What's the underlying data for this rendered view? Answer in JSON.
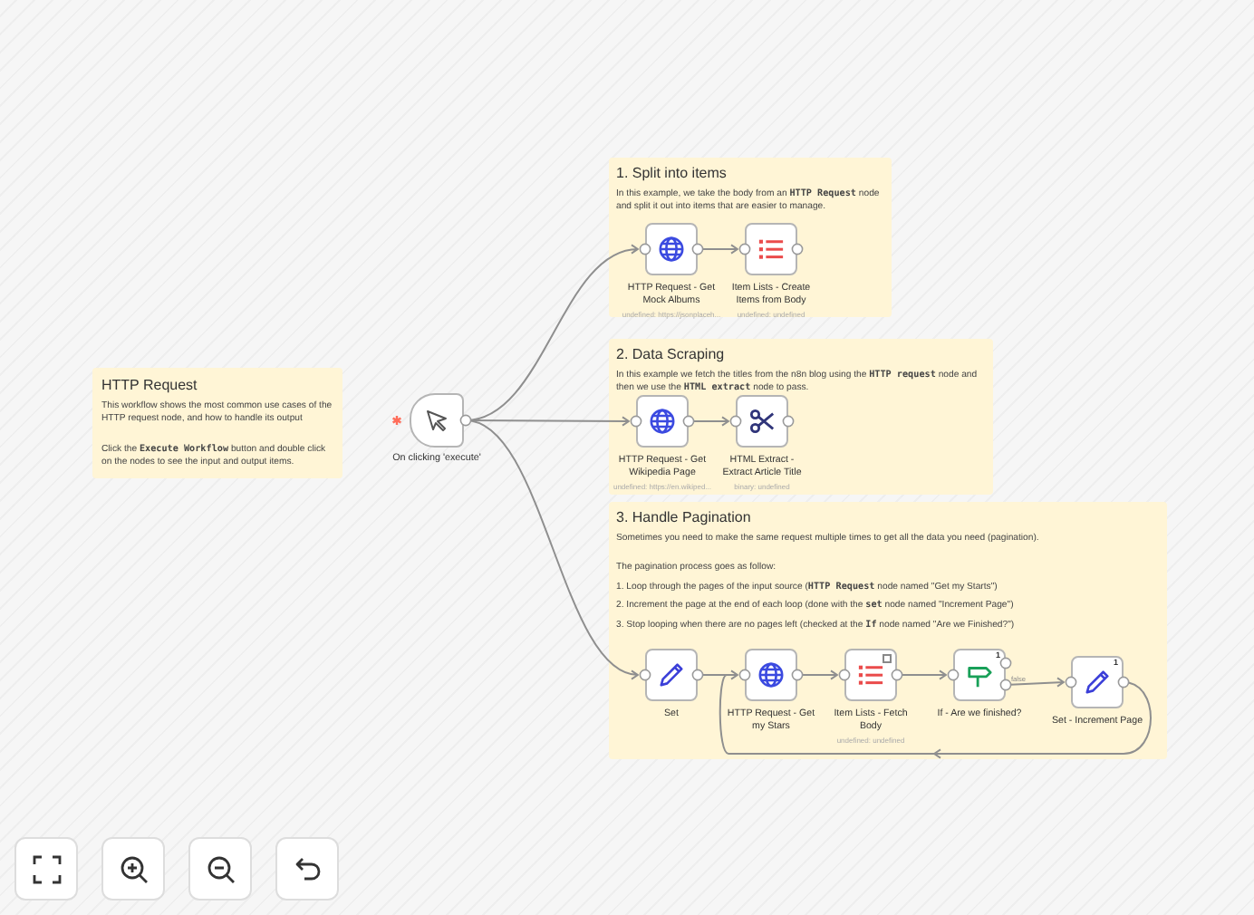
{
  "notes": [
    {
      "title": "HTTP Request",
      "paragraphs": [
        "This workflow shows the most common use cases of the HTTP request node, and how to handle its output",
        "Click the **Execute Workflow** button and double click on the nodes to see the input and output items."
      ]
    },
    {
      "title": "1. Split into items",
      "paragraphs": [
        "In this example, we take the body from an **HTTP Request** node and split it out into items that are easier to manage."
      ]
    },
    {
      "title": "2. Data Scraping",
      "paragraphs": [
        "In this example we fetch the titles from the n8n blog using the **HTTP request** node and then we use the **HTML extract** node to pass."
      ]
    },
    {
      "title": "3. Handle Pagination",
      "paragraphs": [
        "Sometimes you need to make the same request multiple times to get all the data you need (pagination).",
        "The pagination process goes as follow:",
        "1. Loop through the pages of the input source (**HTTP Request** node named \"Get my Starts\")",
        "2. Increment the page at the end of each loop (done with the **set** node named \"Increment Page\")",
        "3. Stop looping when there are no pages left (checked at the **If** node named \"Are we Finished?\")"
      ]
    }
  ],
  "trigger": {
    "label": "On clicking 'execute'"
  },
  "nodes": [
    {
      "kind": "globe",
      "label": "HTTP Request - Get Mock Albums",
      "subtitle": "undefined: https://jsonplaceh..."
    },
    {
      "kind": "list",
      "label": "Item Lists - Create Items from Body",
      "subtitle": "undefined: undefined"
    },
    {
      "kind": "globe",
      "label": "HTTP Request - Get Wikipedia Page",
      "subtitle": "undefined: https://en.wikiped..."
    },
    {
      "kind": "scissors",
      "label": "HTML Extract - Extract Article Title",
      "subtitle": "binary: undefined"
    },
    {
      "kind": "pencil",
      "label": "Set"
    },
    {
      "kind": "globe",
      "label": "HTTP Request - Get my Stars"
    },
    {
      "kind": "list",
      "label": "Item Lists - Fetch Body",
      "subtitle": "undefined: undefined",
      "flag": true
    },
    {
      "kind": "signpost",
      "label": "If - Are we finished?",
      "badge": "1"
    },
    {
      "kind": "pencil",
      "label": "Set - Increment Page",
      "badge": "1"
    }
  ],
  "edge_labels": [
    "false"
  ]
}
